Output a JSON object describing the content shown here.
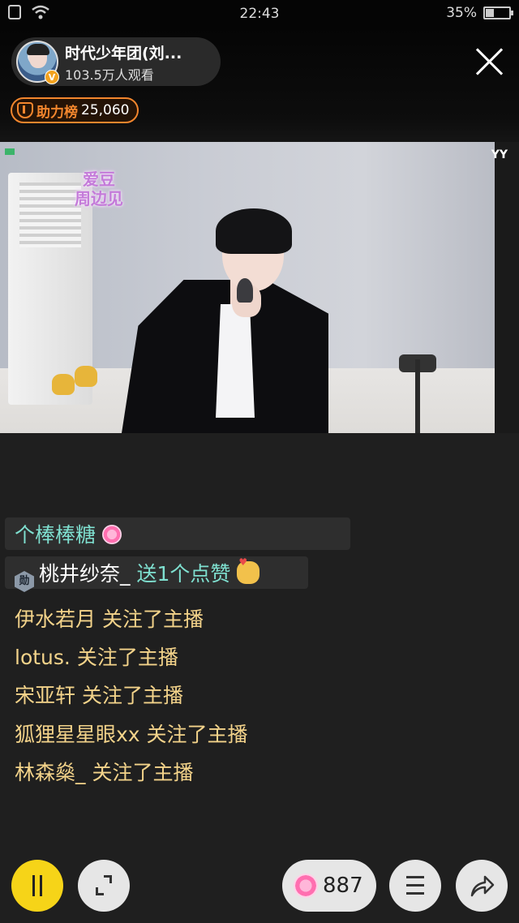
{
  "status_bar": {
    "time": "22:43",
    "battery_percent": "35%",
    "battery_level": 0.35
  },
  "host": {
    "name": "时代少年团(刘...",
    "viewers": "103.5万人观看",
    "verified_badge": "V"
  },
  "rank": {
    "label": "助力榜",
    "value": "25,060"
  },
  "video": {
    "sign_text_line1": "爱豆",
    "sign_text_line2": "周边见",
    "watermark": "YY"
  },
  "chat": [
    {
      "text": "个棒棒糖",
      "color": "teal",
      "icon": "candy-icon",
      "bubble": true
    },
    {
      "level": "勋",
      "user": "桃井纱奈_",
      "action": "送1个点赞",
      "color": "teal",
      "icon": "thumbs-up-hand-icon",
      "bubble": true
    },
    {
      "user": "伊水若月",
      "action": " 关注了主播",
      "color": "gold"
    },
    {
      "user": "lotus.",
      "action": " 关注了主播",
      "color": "gold"
    },
    {
      "user": "宋亚轩",
      "action": " 关注了主播",
      "color": "gold"
    },
    {
      "user": "狐狸星星眼xx",
      "action": " 关注了主播",
      "color": "gold"
    },
    {
      "user": "林森燊_",
      "action": " 关注了主播",
      "color": "gold"
    }
  ],
  "bottom_bar": {
    "gift_count": "887"
  },
  "colors": {
    "accent_yellow": "#f6d418",
    "rank_orange": "#f3862d",
    "chat_teal": "#7fe0d0",
    "chat_gold": "#f3d38a"
  }
}
